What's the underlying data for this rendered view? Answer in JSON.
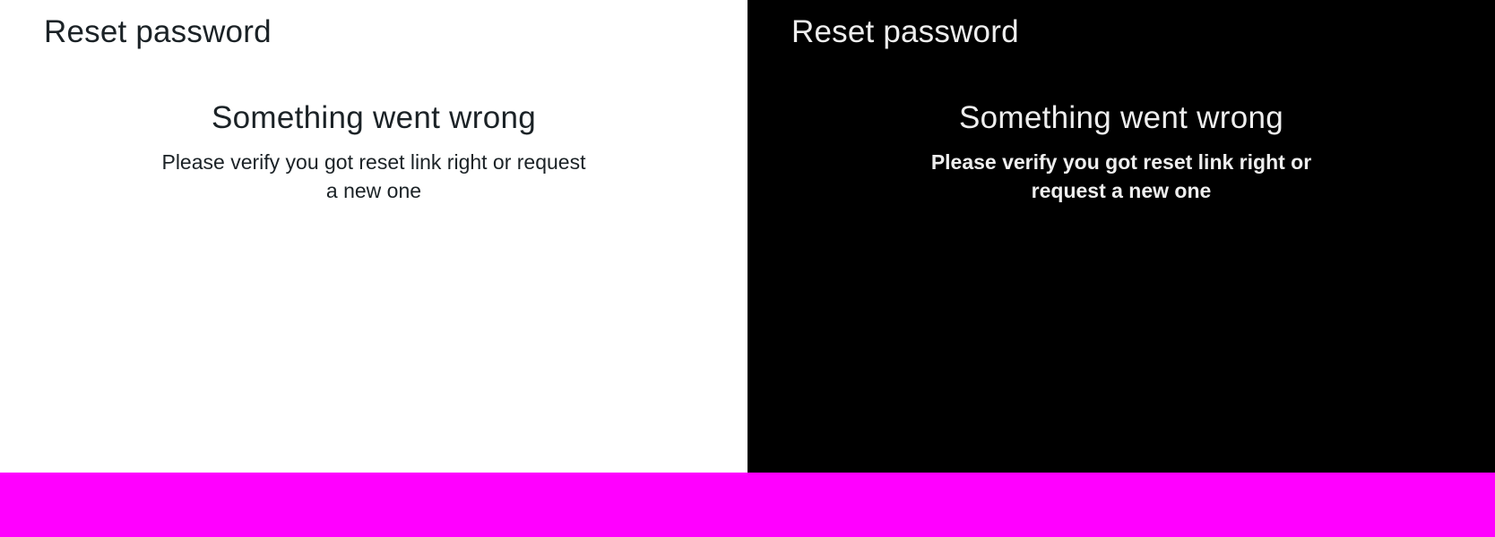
{
  "colors": {
    "light_background": "#ffffff",
    "dark_background": "#000000",
    "light_text": "#1b2226",
    "dark_text": "#eeeeee",
    "band": "#ff00ff"
  },
  "light_panel": {
    "title": "Reset password",
    "error_heading": "Something went wrong",
    "error_message": "Please verify you got reset link right or request a new one"
  },
  "dark_panel": {
    "title": "Reset password",
    "error_heading": "Something went wrong",
    "error_message": "Please verify you got reset link right or request a new one"
  }
}
